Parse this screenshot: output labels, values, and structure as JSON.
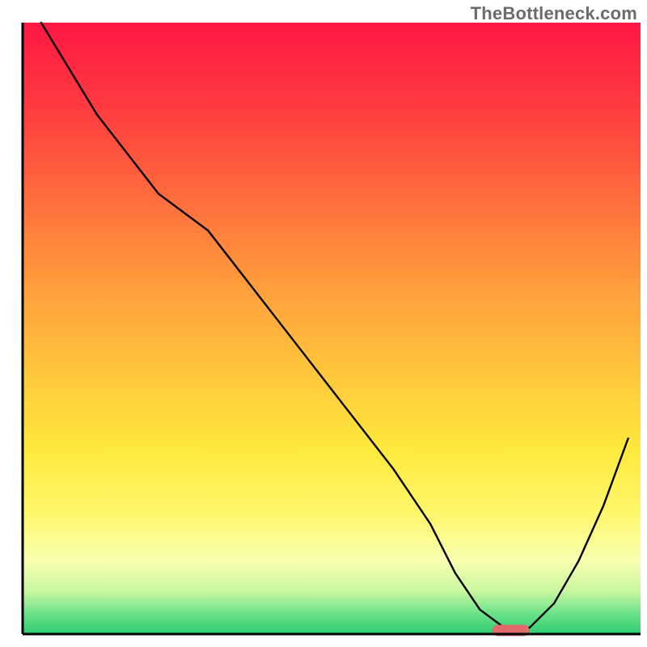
{
  "watermark": "TheBottleneck.com",
  "chart_data": {
    "type": "line",
    "title": "",
    "xlabel": "",
    "ylabel": "",
    "xlim": [
      0,
      100
    ],
    "ylim": [
      0,
      100
    ],
    "series": [
      {
        "name": "bottleneck-curve",
        "x": [
          3,
          12,
          22,
          30,
          40,
          50,
          60,
          66,
          70,
          74,
          78,
          82,
          86,
          90,
          94,
          98
        ],
        "values": [
          100,
          85,
          72,
          66,
          53,
          40,
          27,
          18,
          10,
          4,
          1,
          1,
          5,
          12,
          21,
          32
        ]
      }
    ],
    "marker": {
      "name": "optimal-range",
      "x_start": 76,
      "x_end": 82,
      "y": 0.6
    },
    "gradient_stops": [
      {
        "offset": 0.0,
        "color": "#ff1744"
      },
      {
        "offset": 0.14,
        "color": "#ff3b3f"
      },
      {
        "offset": 0.28,
        "color": "#ff6a3d"
      },
      {
        "offset": 0.42,
        "color": "#ff9a3c"
      },
      {
        "offset": 0.56,
        "color": "#ffc33c"
      },
      {
        "offset": 0.7,
        "color": "#ffe93c"
      },
      {
        "offset": 0.8,
        "color": "#fff76a"
      },
      {
        "offset": 0.88,
        "color": "#f8ffb0"
      },
      {
        "offset": 0.93,
        "color": "#c8f7a0"
      },
      {
        "offset": 0.965,
        "color": "#6fe38a"
      },
      {
        "offset": 1.0,
        "color": "#2ecc71"
      }
    ],
    "marker_color": "#e26a6a",
    "curve_color": "#000000",
    "axis_color": "#000000"
  }
}
